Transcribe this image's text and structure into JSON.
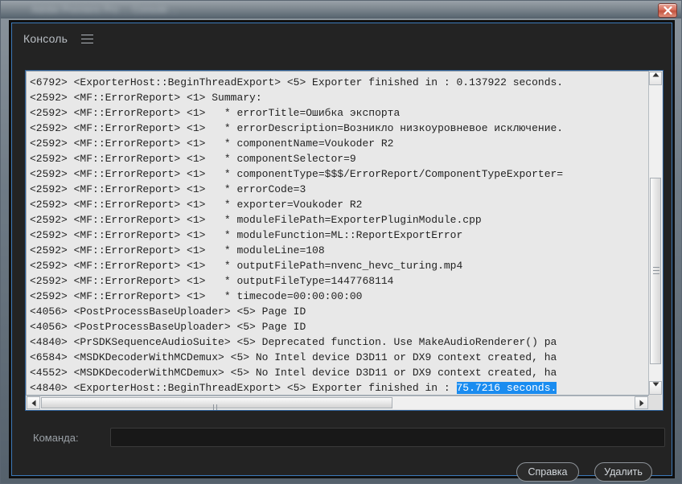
{
  "window": {
    "titlebar_text": "Adobe Premiere Pro ... Console ...",
    "close_icon": "close-icon"
  },
  "panel": {
    "title": "Консоль",
    "menu_icon": "hamburger-menu-icon"
  },
  "log": {
    "lines": [
      [
        {
          "t": "<6792> <ExporterHost::BeginThreadExport> <5> Exporter finished in : 0.137922 seconds.",
          "s": false
        }
      ],
      [
        {
          "t": "<2592> <MF::ErrorReport> <1> Summary:",
          "s": false
        }
      ],
      [
        {
          "t": "<2592> <MF::ErrorReport> <1>   * errorTitle=Ошибка экспорта",
          "s": false
        }
      ],
      [
        {
          "t": "<2592> <MF::ErrorReport> <1>   * errorDescription=Возникло низкоуровневое исключение.",
          "s": false
        }
      ],
      [
        {
          "t": "<2592> <MF::ErrorReport> <1>   * componentName=Voukoder R2",
          "s": false
        }
      ],
      [
        {
          "t": "<2592> <MF::ErrorReport> <1>   * componentSelector=9",
          "s": false
        }
      ],
      [
        {
          "t": "<2592> <MF::ErrorReport> <1>   * componentType=$$$/ErrorReport/ComponentTypeExporter=",
          "s": false
        }
      ],
      [
        {
          "t": "<2592> <MF::ErrorReport> <1>   * errorCode=3",
          "s": false
        }
      ],
      [
        {
          "t": "<2592> <MF::ErrorReport> <1>   * exporter=Voukoder R2",
          "s": false
        }
      ],
      [
        {
          "t": "<2592> <MF::ErrorReport> <1>   * moduleFilePath=ExporterPluginModule.cpp",
          "s": false
        }
      ],
      [
        {
          "t": "<2592> <MF::ErrorReport> <1>   * moduleFunction=ML::ReportExportError",
          "s": false
        }
      ],
      [
        {
          "t": "<2592> <MF::ErrorReport> <1>   * moduleLine=108",
          "s": false
        }
      ],
      [
        {
          "t": "<2592> <MF::ErrorReport> <1>   * outputFilePath=nvenc_hevc_turing.mp4",
          "s": false
        }
      ],
      [
        {
          "t": "<2592> <MF::ErrorReport> <1>   * outputFileType=1447768114",
          "s": false
        }
      ],
      [
        {
          "t": "<2592> <MF::ErrorReport> <1>   * timecode=00:00:00:00",
          "s": false
        }
      ],
      [
        {
          "t": "<4056> <PostProcessBaseUploader> <5> Page ID",
          "s": false
        }
      ],
      [
        {
          "t": "<4056> <PostProcessBaseUploader> <5> Page ID",
          "s": false
        }
      ],
      [
        {
          "t": "<4840> <PrSDKSequenceAudioSuite> <5> Deprecated function. Use MakeAudioRenderer() pa",
          "s": false
        }
      ],
      [
        {
          "t": "<6584> <MSDKDecoderWithMCDemux> <5> No Intel device D3D11 or DX9 context created, ha",
          "s": false
        }
      ],
      [
        {
          "t": "<4552> <MSDKDecoderWithMCDemux> <5> No Intel device D3D11 or DX9 context created, ha",
          "s": false
        }
      ],
      [
        {
          "t": "<4840> <ExporterHost::BeginThreadExport> <5> Exporter finished in : ",
          "s": false
        },
        {
          "t": "75.7216 seconds.",
          "s": true
        }
      ]
    ],
    "selection_text": "75.7216 seconds.",
    "selection_color": "#1a8cf0",
    "vertical_scrollbar": {
      "up_icon": "scroll-up-arrow-icon",
      "down_icon": "scroll-down-arrow-icon"
    },
    "horizontal_scrollbar": {
      "left_icon": "scroll-left-arrow-icon",
      "right_icon": "scroll-right-arrow-icon"
    }
  },
  "command": {
    "label": "Команда:",
    "value": "",
    "placeholder": ""
  },
  "buttons": {
    "help": "Справка",
    "delete": "Удалить"
  },
  "colors": {
    "panel_background": "#232323",
    "panel_border": "#3c79b8",
    "log_background": "#e8e8e8",
    "selection": "#1a8cf0",
    "close_button": "#d9705c"
  }
}
